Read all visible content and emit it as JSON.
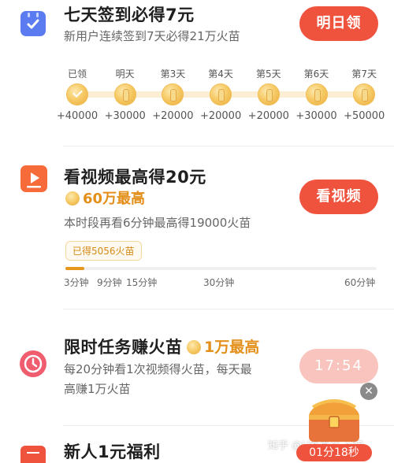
{
  "signin": {
    "title": "七天签到必得7元",
    "subtitle": "新用户连续签到7天必得21万火苗",
    "button": "明日领",
    "days": [
      {
        "label": "已领",
        "reward": "+40000",
        "claimed": true
      },
      {
        "label": "明天",
        "reward": "+30000",
        "claimed": false
      },
      {
        "label": "第3天",
        "reward": "+20000",
        "claimed": false
      },
      {
        "label": "第4天",
        "reward": "+20000",
        "claimed": false
      },
      {
        "label": "第5天",
        "reward": "+20000",
        "claimed": false
      },
      {
        "label": "第6天",
        "reward": "+30000",
        "claimed": false
      },
      {
        "label": "第7天",
        "reward": "+50000",
        "claimed": false
      }
    ]
  },
  "video": {
    "title": "看视频最高得20元",
    "highlight": "60万最高",
    "subtitle": "本时段再看6分钟最高得19000火苗",
    "button": "看视频",
    "earned_tip": "已得5056火苗",
    "progress_fraction": 0.06,
    "marks": [
      "3分钟",
      "9分钟",
      "15分钟",
      "30分钟",
      "60分钟"
    ]
  },
  "limited": {
    "title": "限时任务赚火苗",
    "highlight": "1万最高",
    "desc_line1": "每20分钟看1次视频得火苗，每天最",
    "desc_line2": "高赚1万火苗",
    "timer": "17:54"
  },
  "newbie": {
    "title": "新人1元福利"
  },
  "overlay": {
    "watermark": "知乎 @U客直谈-APP",
    "chest_timer": "01分18秒"
  },
  "colors": {
    "accent": "#f0533d",
    "accent_light": "#f8c4bd",
    "icon_blue": "#5b7cf0",
    "icon_orange": "#f76b3b",
    "icon_pink": "#ef5d6e",
    "gold": "#e38f1a"
  }
}
